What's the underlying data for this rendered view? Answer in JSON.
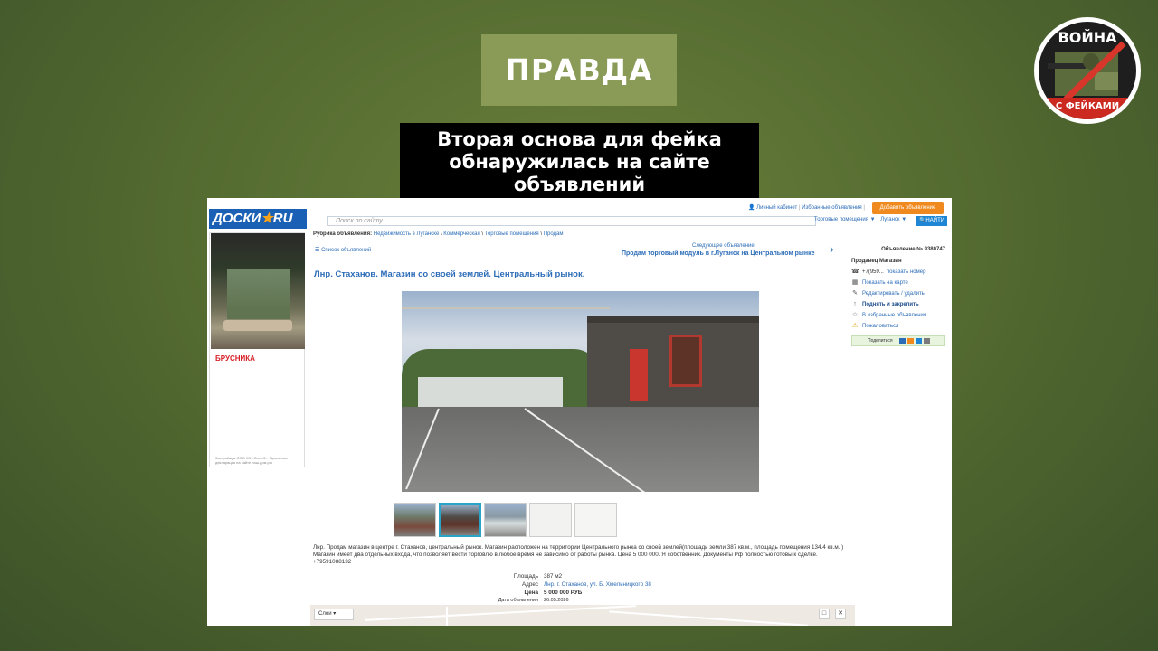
{
  "overlay": {
    "verdict": "ПРАВДА",
    "caption_lines": [
      "Вторая основа для фейка",
      "обнаружилась на сайте",
      "объявлений"
    ],
    "logo_top": "ВОЙНА",
    "logo_bottom": "С ФЕЙКАМИ"
  },
  "site": {
    "logo_text": "ДОСКИ",
    "logo_suffix": "RU",
    "top_links": [
      "Личный кабинет",
      "Избранные объявления"
    ],
    "add_button": "Добавить объявление",
    "search_placeholder": "Поиск по сайту...",
    "filter_category": "Торговые помещения ▼",
    "filter_city": "Луганск ▼",
    "search_button": "НАЙТИ"
  },
  "banner": {
    "brand": "БРУСНИКА",
    "advert_text": "Застройщик ООО СЗ «Сити-3». Проектная декларация на сайте наш.дом.рф"
  },
  "breadcrumbs": {
    "prefix": "Рубрика объявления:",
    "items": [
      "Недвижимость в Луганске",
      "Коммерческая",
      "Торговые помещения",
      "Продам"
    ]
  },
  "listing_link": "Список объявлений",
  "next_listing": {
    "caption": "Следующее объявление",
    "title": "Продам торговый модуль в г.Луганск на Центральном рынке"
  },
  "listing": {
    "title": "Лнр. Стаханов. Магазин со своей землей. Центральный рынок.",
    "description": "Лнр. Продам магазин в центре г. Стаханов, центральный рынок. Магазин расположен на территории Центрального рынка со своей землей(площадь земли 387 кв.м., площадь помещения 134.4 кв.м. ) Магазин имеет два отдельных входа, что позволяет вести торговлю в любое время не зависимо от работы рынка. Цена 5 000 000. Я собственник. Документы Рф полностью готовы к сделке. +79591088132",
    "props": [
      {
        "key": "Площадь",
        "value": "387 м2"
      },
      {
        "key": "Адрес",
        "value": "Лнр, г. Стаханов, ул. Б. Хмельницкого 38"
      },
      {
        "key": "Цена",
        "value": "5 000 000 РУБ"
      },
      {
        "key": "Дата объявления",
        "value": "26.05.2026"
      }
    ]
  },
  "map": {
    "layers_label": "Слои ▾",
    "fullscreen": "□",
    "close": "✕"
  },
  "sidebar": {
    "ad_number": "Объявление № 9380747",
    "seller": "Продавец Магазин",
    "phone": "+7(959...",
    "show_number": "показать номер",
    "actions": [
      "Показать на карте",
      "Редактировать / удалить",
      "Поднять и закрепить",
      "В избранные объявления",
      "Пожаловаться"
    ],
    "share_label": "Поделиться"
  }
}
